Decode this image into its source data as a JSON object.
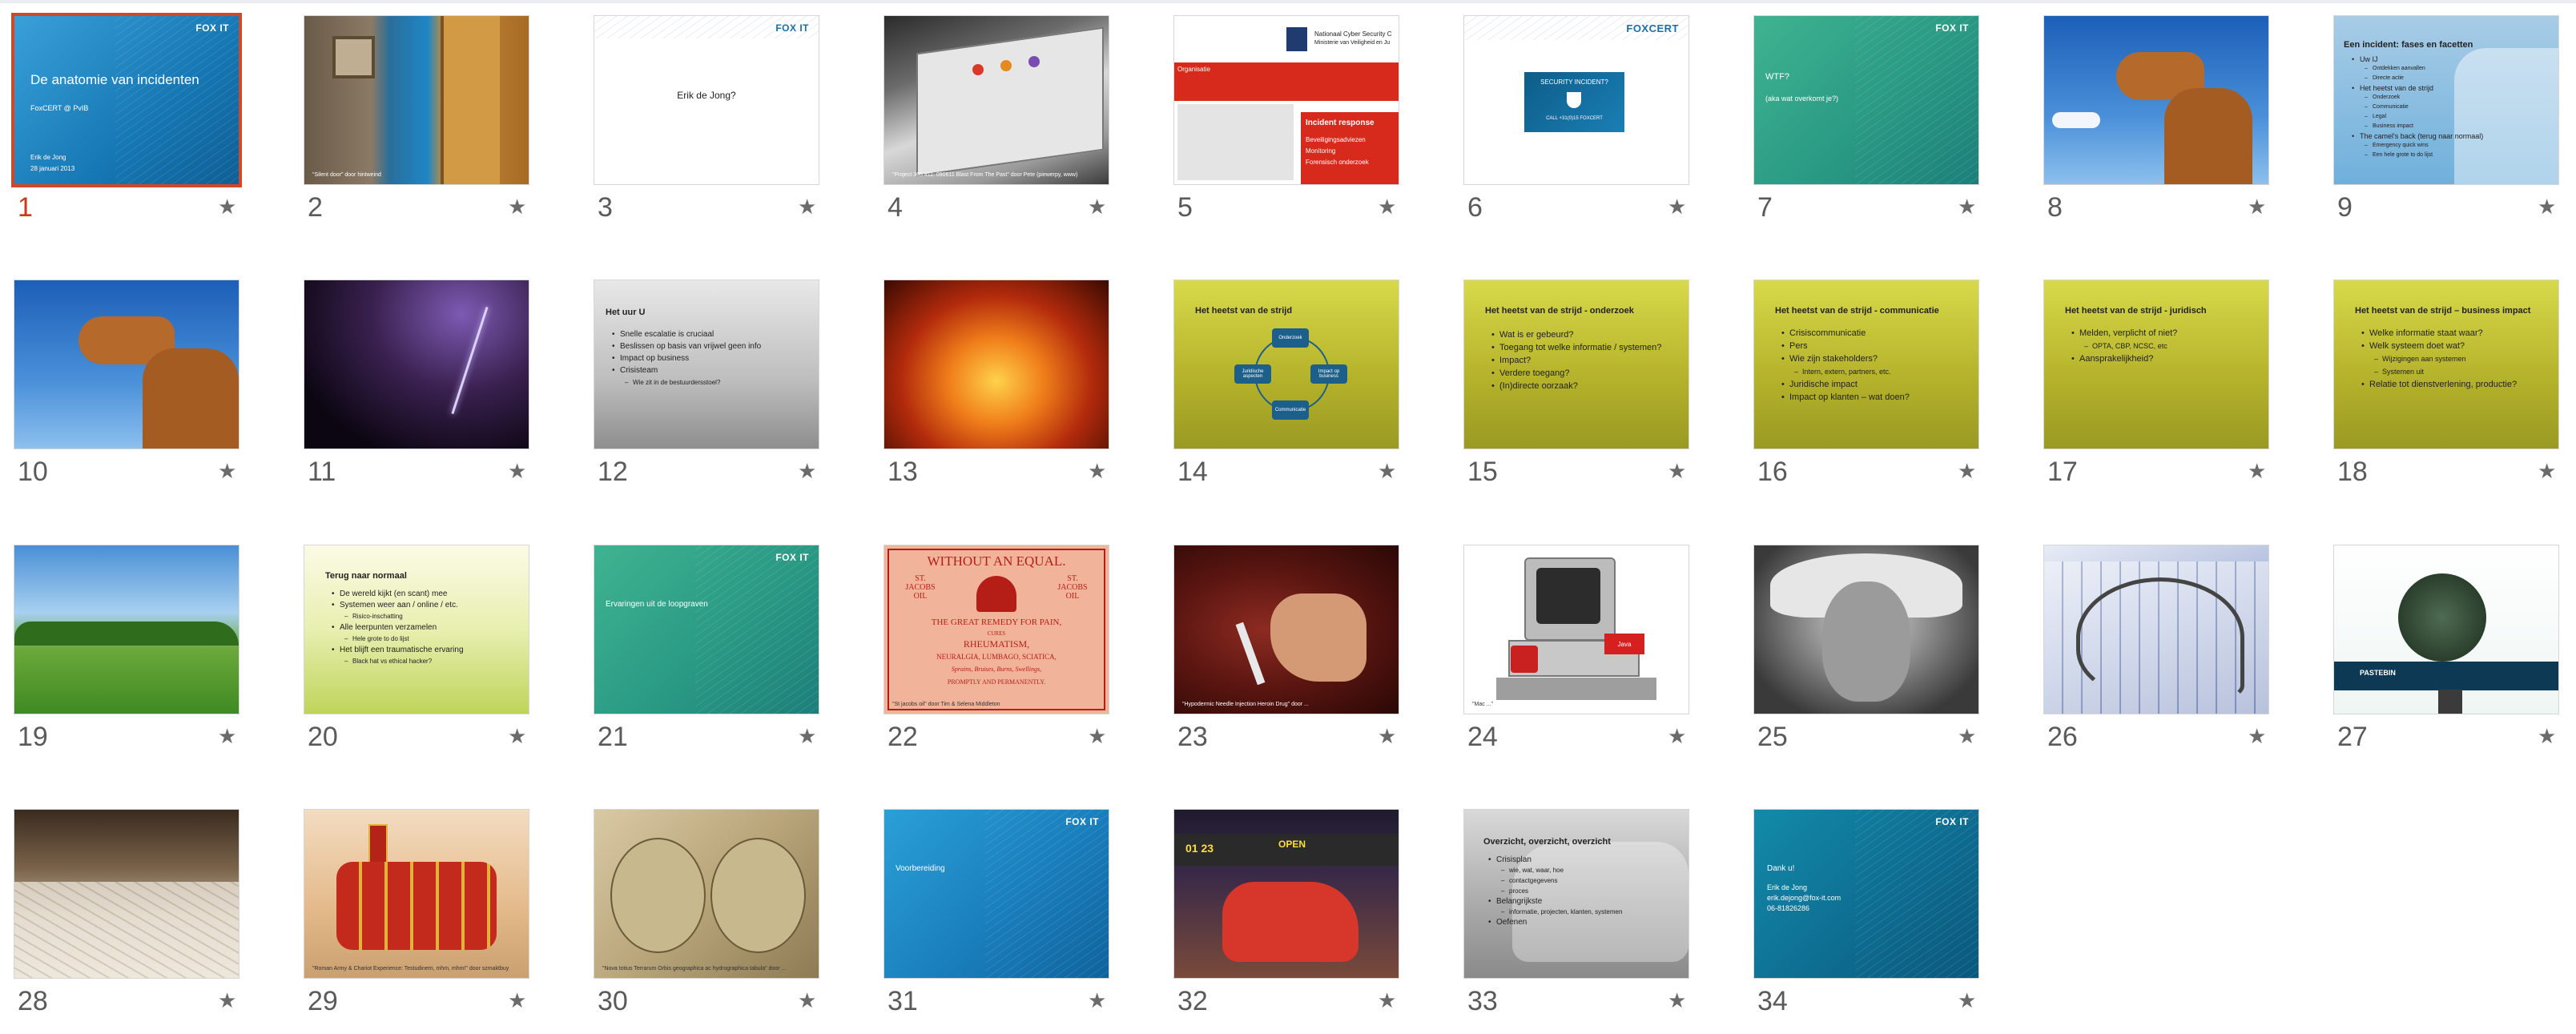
{
  "slides": [
    {
      "number": "1",
      "selected": true,
      "title": "De anatomie van incidenten",
      "subtitle": "FoxCERT @ PvIB",
      "author": "Erik de Jong",
      "date": "28 januari 2013",
      "logo": "FOX IT"
    },
    {
      "number": "2",
      "caption": "\"Silent door\" door hintweind"
    },
    {
      "number": "3",
      "title": "Erik de Jong?",
      "logo": "FOX IT"
    },
    {
      "number": "4",
      "caption": "\"Project 365 #11: 090611 Blast From The Past\" door Pete (piewerpy, www)"
    },
    {
      "number": "5",
      "header_1": "Nationaal Cyber Security C",
      "header_2": "Ministerie van Veiligheid en Ju",
      "label": "Organisatie",
      "panel_title": "Incident response",
      "items": [
        "Beveiligingsadviezen",
        "Monitoring",
        "Forensisch onderzoek"
      ]
    },
    {
      "number": "6",
      "logo": "FOXCERT",
      "badge_line_1": "SECURITY INCIDENT?",
      "badge_line_2": "CALL +31(0)15 FOXCERT"
    },
    {
      "number": "7",
      "title": "WTF?",
      "subtitle": "(aka wat overkomt je?)",
      "logo": "FOX IT"
    },
    {
      "number": "8"
    },
    {
      "number": "9",
      "title": "Een incident: fases en facetten",
      "bullets": [
        {
          "text": "Uw IJ",
          "level": 1
        },
        {
          "text": "Ontdekken aanvallen",
          "level": 2
        },
        {
          "text": "Directe actie",
          "level": 2
        },
        {
          "text": "Het heetst van de strijd",
          "level": 1
        },
        {
          "text": "Onderzoek",
          "level": 2
        },
        {
          "text": "Communicatie",
          "level": 2
        },
        {
          "text": "Legal",
          "level": 2
        },
        {
          "text": "Business impact",
          "level": 2
        },
        {
          "text": "The camel's back (terug naar normaal)",
          "level": 1
        },
        {
          "text": "Emergency quick wins",
          "level": 2
        },
        {
          "text": "Een hele grote to do lijst",
          "level": 2
        }
      ]
    },
    {
      "number": "10"
    },
    {
      "number": "11"
    },
    {
      "number": "12",
      "title": "Het uur U",
      "bullets": [
        {
          "text": "Snelle escalatie is cruciaal",
          "level": 1
        },
        {
          "text": "Beslissen op basis van vrijwel geen info",
          "level": 1
        },
        {
          "text": "Impact op business",
          "level": 1
        },
        {
          "text": "Crisisteam",
          "level": 1
        },
        {
          "text": "Wie zit in de bestuurdersstoel?",
          "level": 2
        }
      ]
    },
    {
      "number": "13"
    },
    {
      "number": "14",
      "title": "Het heetst van de strijd",
      "nodes": [
        "Onderzoek",
        "Impact op business",
        "Communicatie",
        "Juridische aspecten"
      ]
    },
    {
      "number": "15",
      "title": "Het heetst van de strijd - onderzoek",
      "bullets": [
        {
          "text": "Wat is er gebeurd?",
          "level": 1
        },
        {
          "text": "Toegang tot welke informatie / systemen?",
          "level": 1
        },
        {
          "text": "Impact?",
          "level": 1
        },
        {
          "text": "Verdere toegang?",
          "level": 1
        },
        {
          "text": "(In)directe oorzaak?",
          "level": 1
        }
      ]
    },
    {
      "number": "16",
      "title": "Het heetst van de strijd - communicatie",
      "bullets": [
        {
          "text": "Crisiscommunicatie",
          "level": 1
        },
        {
          "text": "Pers",
          "level": 1
        },
        {
          "text": "Wie zijn stakeholders?",
          "level": 1
        },
        {
          "text": "Intern, extern, partners, etc.",
          "level": 2
        },
        {
          "text": "Juridische impact",
          "level": 1
        },
        {
          "text": "Impact op klanten – wat doen?",
          "level": 1
        }
      ]
    },
    {
      "number": "17",
      "title": "Het heetst van de strijd - juridisch",
      "bullets": [
        {
          "text": "Melden, verplicht of niet?",
          "level": 1
        },
        {
          "text": "OPTA, CBP, NCSC, etc",
          "level": 2
        },
        {
          "text": "Aansprakelijkheid?",
          "level": 1
        }
      ]
    },
    {
      "number": "18",
      "title": "Het heetst van de strijd – business impact",
      "bullets": [
        {
          "text": "Welke informatie staat waar?",
          "level": 1
        },
        {
          "text": "Welk systeem doet wat?",
          "level": 1
        },
        {
          "text": "Wijzigingen aan systemen",
          "level": 2
        },
        {
          "text": "Systemen uit",
          "level": 2
        },
        {
          "text": "Relatie tot dienstverlening, productie?",
          "level": 1
        }
      ]
    },
    {
      "number": "19"
    },
    {
      "number": "20",
      "title": "Terug naar normaal",
      "bullets": [
        {
          "text": "De wereld kijkt (en scant) mee",
          "level": 1
        },
        {
          "text": "Systemen weer aan / online / etc.",
          "level": 1
        },
        {
          "text": "Risico-inschatting",
          "level": 2
        },
        {
          "text": "Alle leerpunten verzamelen",
          "level": 1
        },
        {
          "text": "Hele grote to do lijst",
          "level": 2
        },
        {
          "text": "Het blijft een traumatische ervaring",
          "level": 1
        },
        {
          "text": "Black hat vs ethical hacker?",
          "level": 2
        }
      ]
    },
    {
      "number": "21",
      "title": "Ervaringen uit de loopgraven",
      "logo": "FOX IT"
    },
    {
      "number": "22",
      "line_1": "WITHOUT AN EQUAL.",
      "left": "ST. JACOBS OIL",
      "right": "ST. JACOBS OIL",
      "line_2": "THE GREAT REMEDY FOR PAIN,",
      "line_3": "CURES",
      "line_4": "RHEUMATISM,",
      "line_5": "NEURALGIA, LUMBAGO, SCIATICA,",
      "line_6": "Sprains, Bruises, Burns, Swellings,",
      "line_7": "PROMPTLY AND PERMANENTLY.",
      "caption": "\"St jacobs oil\" door Tim & Selena Middleton"
    },
    {
      "number": "23",
      "caption": "\"Hypodermic Needle Injection Heroin Drug\" door ..."
    },
    {
      "number": "24",
      "caption": "\"Mac ...\"",
      "badge": "Java"
    },
    {
      "number": "25"
    },
    {
      "number": "26"
    },
    {
      "number": "27",
      "banner": "PASTEBIN"
    },
    {
      "number": "28"
    },
    {
      "number": "29",
      "caption": "\"Roman Army & Chariot Experience: Testudinem, mhm, mhm!\" door szmaktbuy"
    },
    {
      "number": "30",
      "caption": "\"Nova totius Terrarum Orbis geographica ac hydrographica tabula\" door ..."
    },
    {
      "number": "31",
      "title": "Voorbereiding",
      "logo": "FOX IT"
    },
    {
      "number": "32",
      "text_left": "01 23",
      "text_right": "OPEN"
    },
    {
      "number": "33",
      "title": "Overzicht, overzicht, overzicht",
      "bullets": [
        {
          "text": "Crisisplan",
          "level": 1
        },
        {
          "text": "wie, wat, waar, hoe",
          "level": 2
        },
        {
          "text": "contactgegevens",
          "level": 2
        },
        {
          "text": "proces",
          "level": 2
        },
        {
          "text": "Belangrijkste",
          "level": 1
        },
        {
          "text": "informatie, projecten, klanten, systemen",
          "level": 2
        },
        {
          "text": "Oefenen",
          "level": 1
        }
      ]
    },
    {
      "number": "34",
      "title": "Dank u!",
      "contact": [
        "Erik de Jong",
        "erik.dejong@fox-it.com",
        "06-81826286"
      ],
      "logo": "FOX IT"
    }
  ],
  "colors": {
    "selected": "#d24726",
    "star": "#6b6b6b",
    "number": "#5a5a5a"
  },
  "icons": {
    "star": "★"
  }
}
